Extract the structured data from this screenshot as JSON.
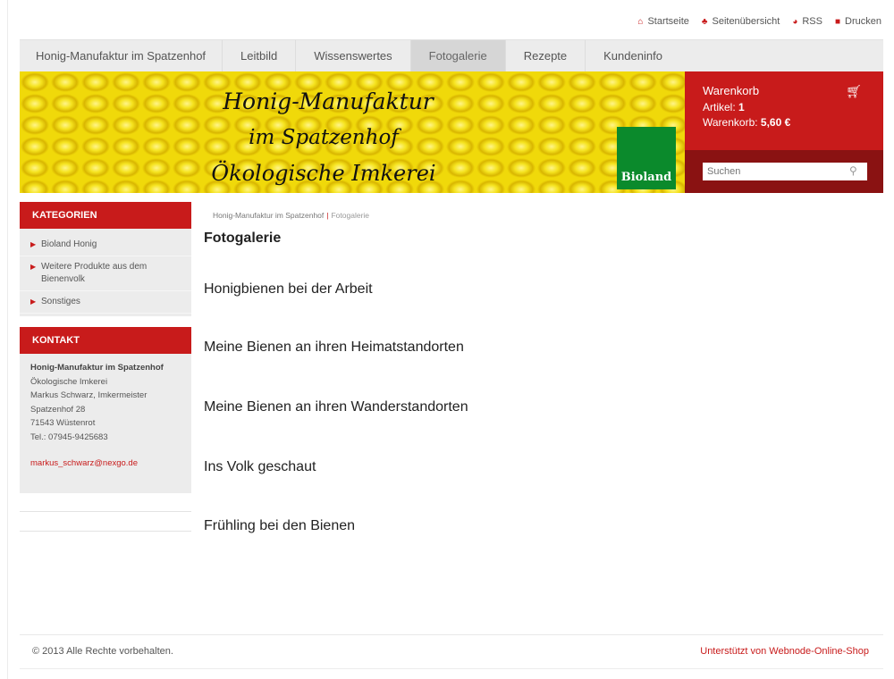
{
  "toplinks": [
    {
      "label": "Startseite",
      "icon": "home-icon"
    },
    {
      "label": "Seitenübersicht",
      "icon": "sitemap-icon"
    },
    {
      "label": "RSS",
      "icon": "rss-icon"
    },
    {
      "label": "Drucken",
      "icon": "print-icon"
    }
  ],
  "nav": {
    "tabs": [
      "Honig-Manufaktur im Spatzenhof",
      "Leitbild",
      "Wissenswertes",
      "Fotogalerie",
      "Rezepte",
      "Kundeninfo"
    ],
    "active": "Fotogalerie"
  },
  "banner": {
    "line1": "Honig-Manufaktur",
    "line2": "im Spatzenhof",
    "line3": "Ökologische Imkerei",
    "logo": "Bioland"
  },
  "cart": {
    "title": "Warenkorb",
    "items_label": "Artikel:",
    "items_value": "1",
    "total_label": "Warenkorb:",
    "total_value": "5,60 €"
  },
  "search": {
    "placeholder": "Suchen"
  },
  "categories": {
    "heading": "KATEGORIEN",
    "items": [
      "Bioland Honig",
      "Weitere Produkte aus dem Bienenvolk",
      "Sonstiges"
    ]
  },
  "contact": {
    "heading": "KONTAKT",
    "name": "Honig-Manufaktur im Spatzenhof",
    "line1": "Ökologische Imkerei",
    "line2": "Markus Schwarz, Imkermeister",
    "line3": "Spatzenhof 28",
    "line4": "71543 Wüstenrot",
    "line5": "Tel.: 07945-9425683",
    "email": "markus_schwarz@nexgo.de"
  },
  "breadcrumb": {
    "home": "Honig-Manufaktur im Spatzenhof",
    "sep": "|",
    "current": "Fotogalerie"
  },
  "page": {
    "title": "Fotogalerie",
    "galleries": [
      "Honigbienen bei der Arbeit",
      "Meine Bienen an ihren Heimatstandorten",
      "Meine Bienen an ihren Wanderstandorten",
      "Ins Volk geschaut",
      "Frühling bei den Bienen"
    ]
  },
  "footer": {
    "copyright": "© 2013 Alle Rechte vorbehalten.",
    "powered": "Unterstützt von Webnode-Online-Shop"
  },
  "colors": {
    "accent": "#c81b1b",
    "nav_bg": "#ececec",
    "honey": "#f0d90a",
    "bioland_green": "#0b8a2c"
  }
}
